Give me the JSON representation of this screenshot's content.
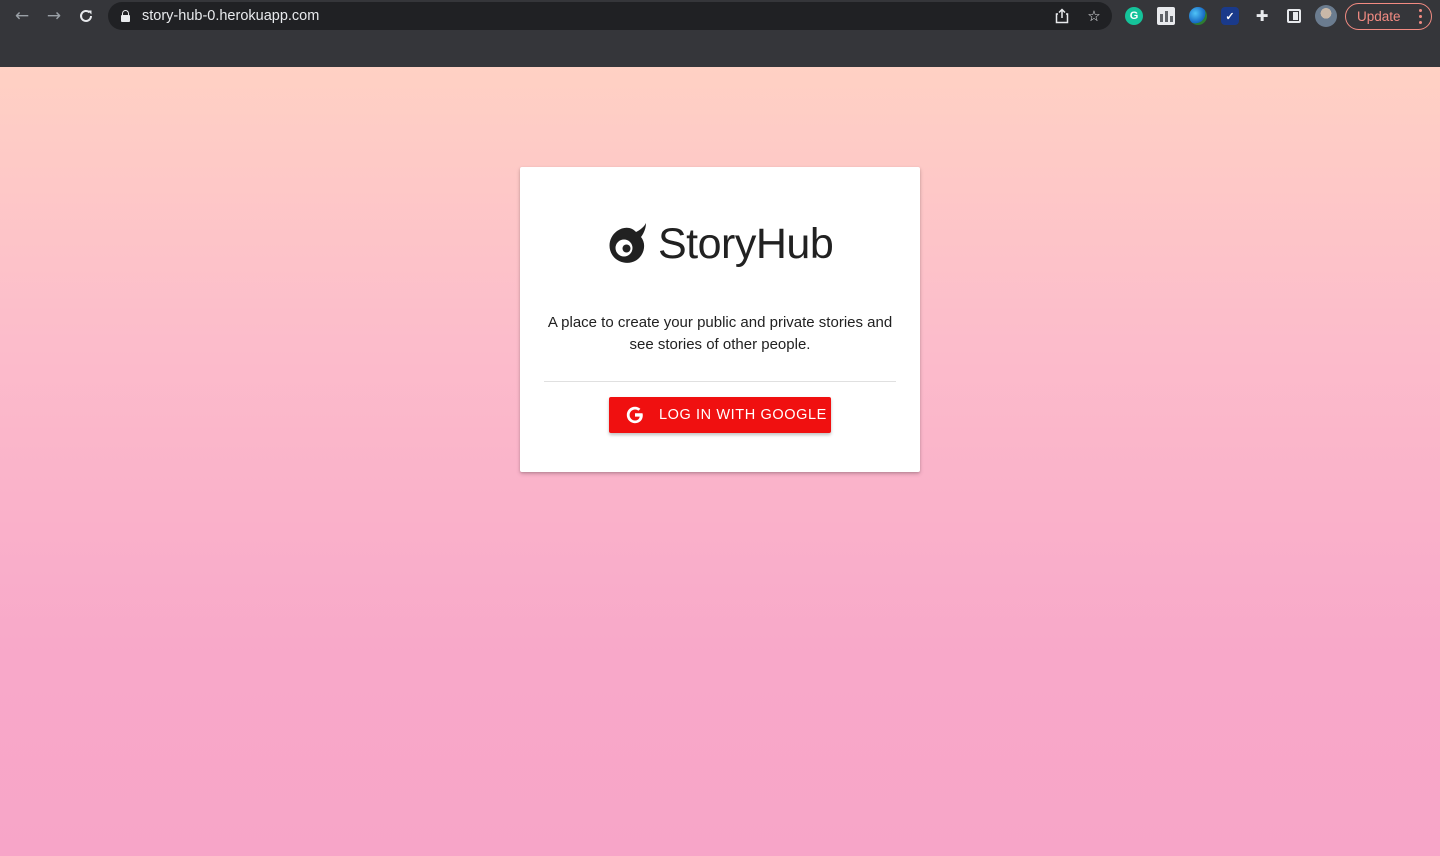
{
  "browser": {
    "url": "story-hub-0.herokuapp.com",
    "back_icon": "arrow-left-icon",
    "forward_icon": "arrow-right-icon",
    "reload_icon": "reload-icon",
    "update_label": "Update",
    "extensions": [
      "grammarly-icon",
      "bar-chart-extension-icon",
      "globe-extension-icon",
      "checkmark-extension-icon",
      "puzzle-icon",
      "side-panel-icon"
    ]
  },
  "card": {
    "brand": "StoryHub",
    "tagline": "A place to create your public and private stories and see stories of other people.",
    "login_label": "LOG IN WITH GOOGLE"
  },
  "colors": {
    "button_red": "#f01010",
    "gradient_top": "#ffd1c4",
    "gradient_bottom": "#f7a5c8",
    "chrome_bg": "#35363a",
    "update_accent": "#f28b82"
  }
}
